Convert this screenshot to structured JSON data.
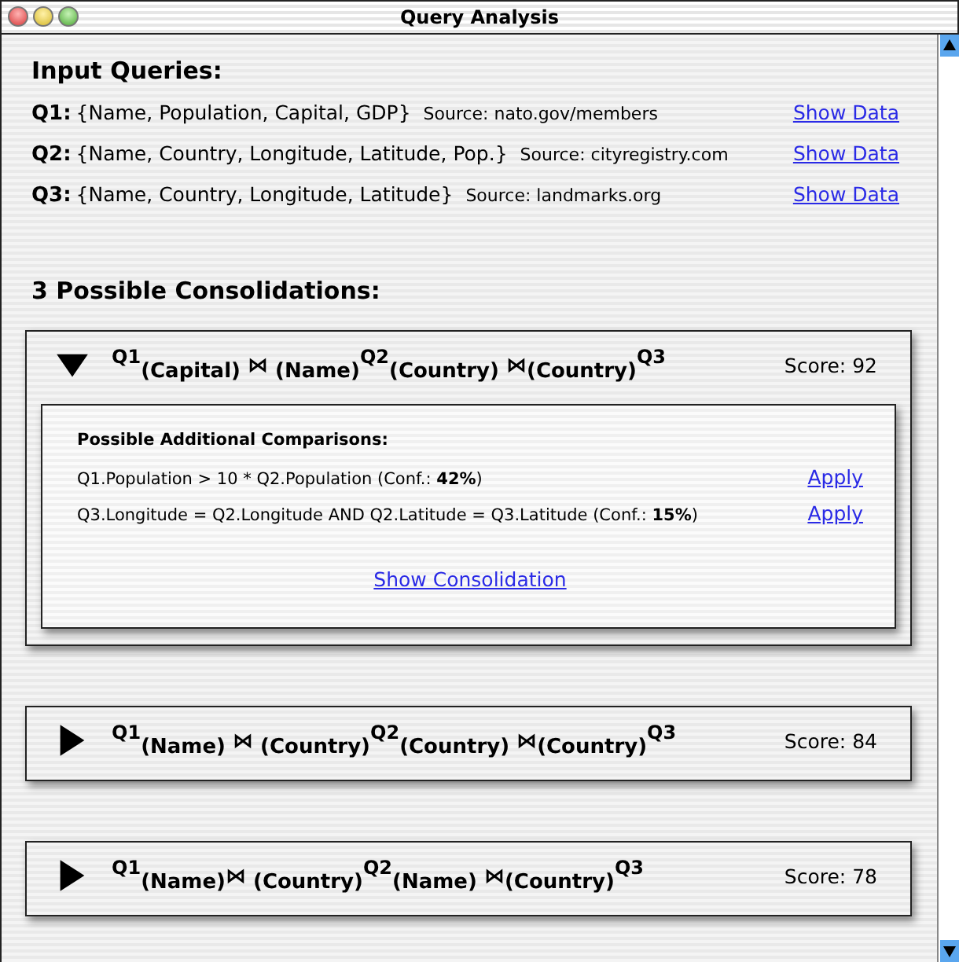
{
  "window": {
    "title": "Query Analysis"
  },
  "input_queries": {
    "heading": "Input Queries:",
    "queries": [
      {
        "label": "Q1:",
        "fields": "{Name, Population, Capital, GDP}",
        "source": "Source: nato.gov/members",
        "link": "Show Data"
      },
      {
        "label": "Q2:",
        "fields": "{Name, Country, Longitude, Latitude, Pop.}",
        "source": "Source: cityregistry.com",
        "link": "Show Data"
      },
      {
        "label": "Q3:",
        "fields": "{Name, Country, Longitude, Latitude}",
        "source": "Source: landmarks.org",
        "link": "Show Data"
      }
    ]
  },
  "consolidations": {
    "heading": "3 Possible Consolidations:",
    "items": [
      {
        "expanded": true,
        "expression": "$^{Q1}$$_{(Capital)}$ ⋈ $_{(Name)}$$^{Q2}$$_{(Country)}$ ⋈$_{(Country)}$$^{Q3}$",
        "score": "Score: 92",
        "details": {
          "heading": "Possible Additional Comparisons:",
          "comparisons": [
            {
              "text": "Q1.Population > 10 * Q2.Population (Conf.: **42%**)",
              "action": "Apply"
            },
            {
              "text": "Q3.Longitude = Q2.Longitude AND Q2.Latitude = Q3.Latitude (Conf.: **15%**)",
              "action": "Apply"
            }
          ],
          "link": "Show Consolidation"
        }
      },
      {
        "expanded": false,
        "expression": "$^{Q1}$$_{(Name)}$ ⋈ $_{(Country)}$$^{Q2}$$_{(Country)}$ ⋈$_{(Country)}$$^{Q3}$",
        "score": "Score: 84"
      },
      {
        "expanded": false,
        "expression": "$^{Q1}$$_{(Name)}$⋈ $_{(Country)}$$^{Q2}$$_{(Name)}$ ⋈$_{(Country)}$$^{Q3}$",
        "score": "Score: 78"
      }
    ]
  }
}
